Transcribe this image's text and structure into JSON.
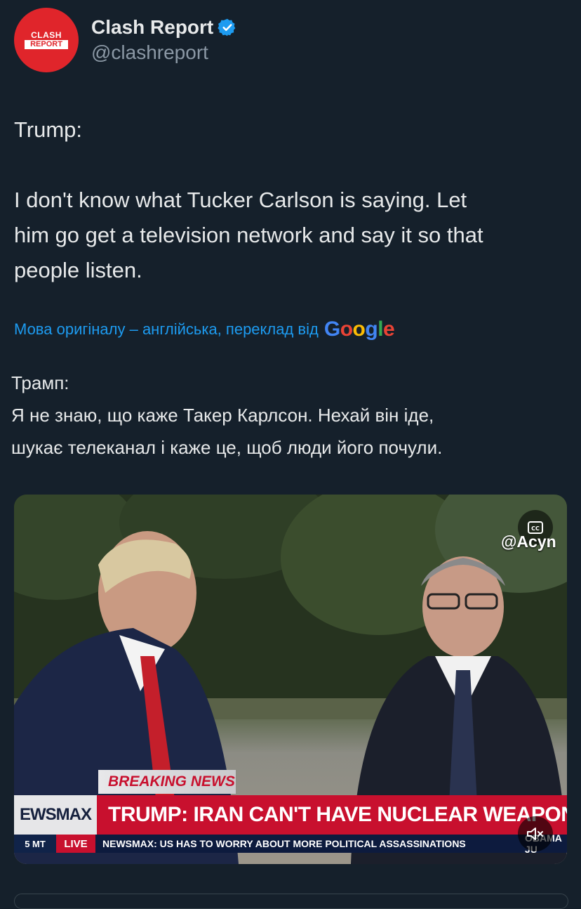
{
  "author": {
    "avatar_top": "CLASH",
    "avatar_bottom": "REPORT",
    "display_name": "Clash Report",
    "handle": "@clashreport",
    "verified_icon": "verified-badge-icon",
    "verified_color": "#1d9bf0"
  },
  "tweet": {
    "text": "Trump:\n\nI don't know what Tucker Carlson is saying. Let\nhim go get a television network and say it so that\npeople listen."
  },
  "translation": {
    "note": "Мова оригіналу – англійська, переклад від",
    "provider": {
      "g1": "G",
      "o1": "o",
      "o2": "o",
      "g2": "g",
      "l": "l",
      "e": "e"
    },
    "text": "Трамп:\nЯ не знаю, що каже Такер Карлсон. Нехай він іде,\nшукає телеканал і каже це, щоб люди його почули."
  },
  "media": {
    "type": "video",
    "watermark": "@Acyn",
    "captions_icon": "closed-captions-icon",
    "mute_icon": "speaker-muted-icon",
    "breaking_label": "BREAKING NEWS",
    "network": "EWSMAX",
    "headline": "TRUMP: IRAN CAN'T HAVE NUCLEAR WEAPON",
    "ticker_time": "5 MT",
    "ticker_live": "LIVE",
    "ticker_text": "NEWSMAX: US HAS TO WORRY ABOUT MORE POLITICAL ASSASSINATIONS",
    "ticker_right": "OBAMA JU"
  },
  "colors": {
    "background": "#15202b",
    "link": "#1d9bf0",
    "accent_red": "#c8102e"
  }
}
